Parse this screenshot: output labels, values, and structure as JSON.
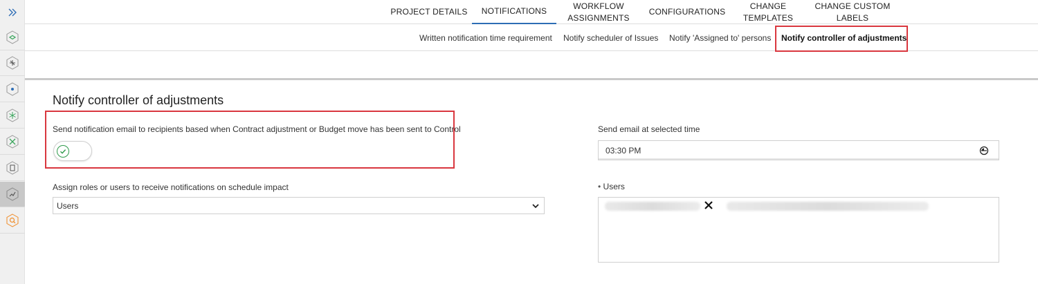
{
  "rail": {
    "toggle_icon": "double-chevron-right-icon",
    "items": [
      {
        "icon": "hexagon-layers-icon",
        "color": "#3aa55c"
      },
      {
        "icon": "hexagon-network-icon",
        "color": "#555555"
      },
      {
        "icon": "hexagon-target-icon",
        "color": "#2d6db5"
      },
      {
        "icon": "hexagon-sparkle-icon",
        "color": "#3aa55c"
      },
      {
        "icon": "hexagon-tools-icon",
        "color": "#3aa55c"
      },
      {
        "icon": "hexagon-document-icon",
        "color": "#555555"
      },
      {
        "icon": "hexagon-chart-icon",
        "color": "#555555"
      },
      {
        "icon": "hexagon-search-icon",
        "color": "#f08a24"
      }
    ]
  },
  "top_tabs": [
    {
      "label": "PROJECT DETAILS"
    },
    {
      "label": "NOTIFICATIONS",
      "active": true
    },
    {
      "label": "WORKFLOW ASSIGNMENTS"
    },
    {
      "label": "CONFIGURATIONS"
    },
    {
      "label": "CHANGE TEMPLATES"
    },
    {
      "label": "CHANGE CUSTOM LABELS"
    }
  ],
  "sub_tabs": [
    {
      "label": "Written notification time requirement"
    },
    {
      "label": "Notify scheduler of Issues"
    },
    {
      "label": "Notify 'Assigned to' persons"
    },
    {
      "label": "Notify controller of adjustments",
      "active": true
    }
  ],
  "form": {
    "title": "Notify controller of adjustments",
    "toggle_label": "Send notification email to recipients based when Contract adjustment or Budget move has been sent to Control",
    "toggle_on": true,
    "assign_label": "Assign roles or users to receive notifications on schedule impact",
    "assign_value": "Users",
    "time_label": "Send email at selected time",
    "time_value": "03:30 PM",
    "users_label": "Users",
    "users_required_marker": "•"
  },
  "colors": {
    "accent": "#2d6db5",
    "highlight_red": "#d9363e",
    "toggle_green": "#2e9a4a"
  }
}
